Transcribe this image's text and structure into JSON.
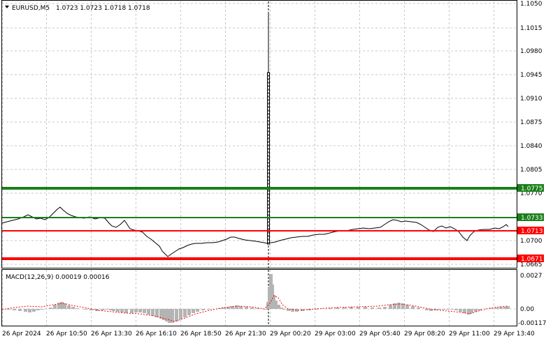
{
  "header": {
    "symbol_label": "EURUSD,M5",
    "ohlc": "1.0723 1.0723 1.0718 1.0718"
  },
  "macd": {
    "label": "MACD(12,26,9) 0.00019 0.00016",
    "axis_labels": [
      "0.0027",
      "0.00",
      "-0.00117"
    ]
  },
  "price_axis": {
    "labels": [
      "1.1050",
      "1.1015",
      "1.0980",
      "1.0945",
      "1.0910",
      "1.0875",
      "1.0840",
      "1.0805",
      "1.0770",
      "1.0700",
      "1.0665"
    ]
  },
  "time_axis": {
    "labels": [
      "26 Apr 2024",
      "26 Apr 10:50",
      "26 Apr 13:30",
      "26 Apr 16:10",
      "26 Apr 18:50",
      "26 Apr 21:30",
      "29 Apr 00:20",
      "29 Apr 03:00",
      "29 Apr 05:40",
      "29 Apr 08:20",
      "29 Apr 11:00",
      "29 Apr 13:40"
    ]
  },
  "levels": [
    {
      "value": "1.0775",
      "color": "#1a7f1a",
      "thickness": "thick"
    },
    {
      "value": "1.0733",
      "color": "#1a7f1a",
      "thickness": "thin"
    },
    {
      "value": "1.0713",
      "color": "#ff0000",
      "thickness": "thin"
    },
    {
      "value": "1.0671",
      "color": "#ff0000",
      "thickness": "thick"
    }
  ],
  "colors": {
    "price_line": "#000000",
    "histogram": "#b4b4b4",
    "signal": "#ff0000",
    "grid": "#c8c8c8"
  }
}
